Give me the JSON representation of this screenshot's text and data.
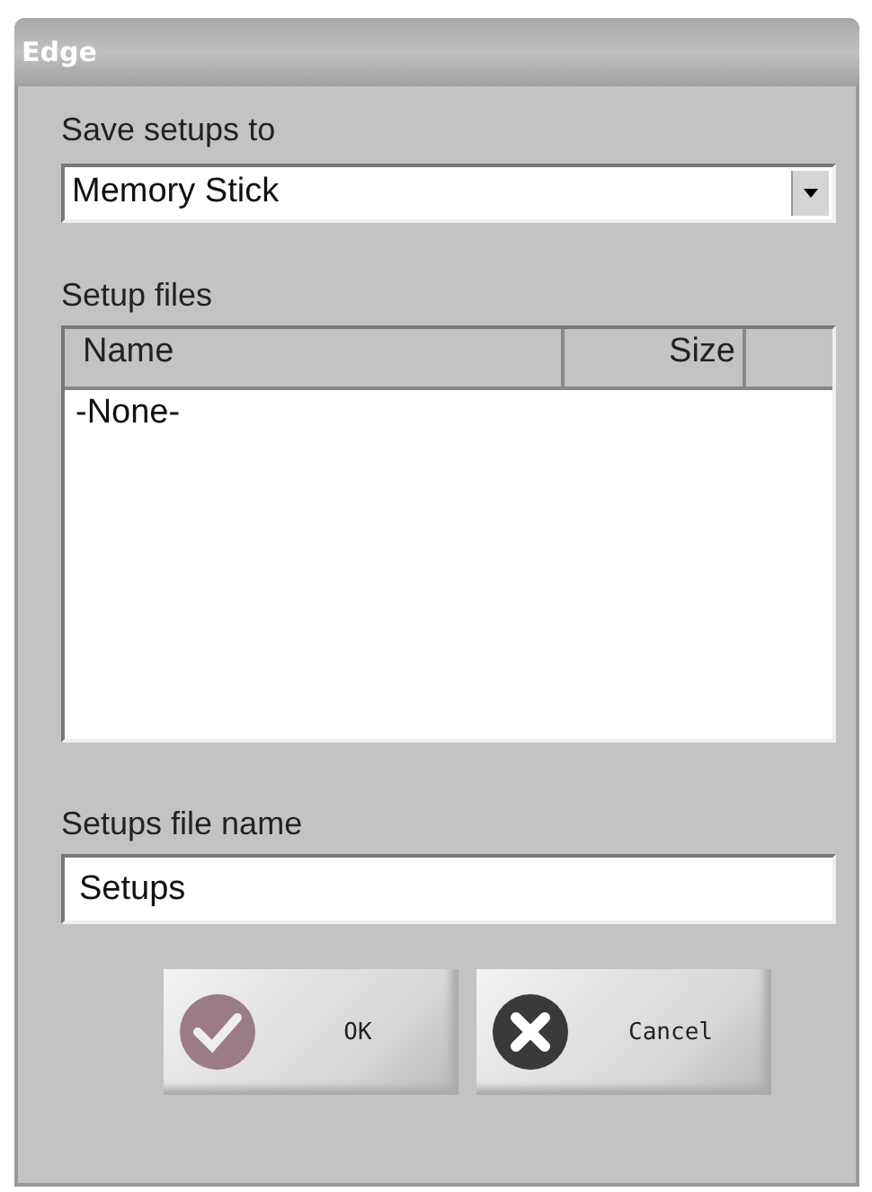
{
  "window": {
    "title": "Edge"
  },
  "save_to": {
    "label": "Save setups to",
    "value": "Memory Stick"
  },
  "setup_files": {
    "label": "Setup files",
    "columns": [
      "Name",
      "Size"
    ],
    "rows": [
      "-None-"
    ]
  },
  "file_name": {
    "label": "Setups file name",
    "value": "Setups"
  },
  "buttons": [
    {
      "kind": "ok",
      "label": "OK"
    },
    {
      "kind": "cancel",
      "label": "Cancel"
    }
  ]
}
